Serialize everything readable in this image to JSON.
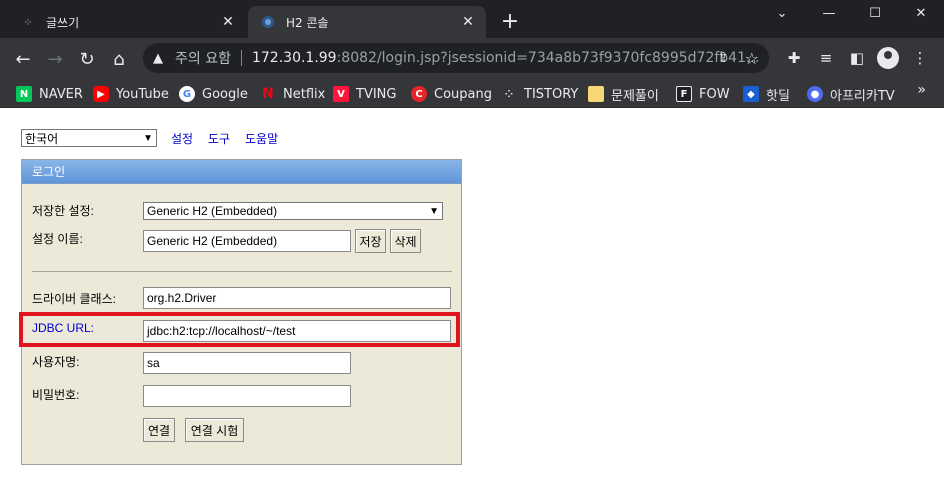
{
  "browser": {
    "tabs": [
      {
        "title": "글쓰기",
        "active": false
      },
      {
        "title": "H2 콘솔",
        "active": true
      }
    ],
    "new_tab": "+",
    "window_controls": {
      "minimize": "—",
      "maximize": "☐",
      "close": "✕",
      "tab_search": "⌄"
    },
    "address": {
      "security_label": "주의 요함",
      "host": "172.30.1.99",
      "rest": ":8082/login.jsp?jsessionid=734a8b73f9370fc8995d72fb41..."
    },
    "bookmarks": [
      {
        "label": "NAVER",
        "icon": "naver-icon",
        "color": "#03c75a",
        "glyph": "N"
      },
      {
        "label": "YouTube",
        "icon": "youtube-icon",
        "color": "#ff0000",
        "glyph": "▶"
      },
      {
        "label": "Google",
        "icon": "google-icon",
        "color": "#4285f4",
        "glyph": "G"
      },
      {
        "label": "Netflix",
        "icon": "netflix-icon",
        "color": "#e50914",
        "glyph": "N"
      },
      {
        "label": "TVING",
        "icon": "tving-icon",
        "color": "#ff153c",
        "glyph": "V"
      },
      {
        "label": "Coupang",
        "icon": "coupang-icon",
        "color": "#e52528",
        "glyph": "C"
      },
      {
        "label": "TISTORY",
        "icon": "tistory-icon",
        "color": "#35363a",
        "glyph": "⁘"
      },
      {
        "label": "문제풀이",
        "icon": "folder-icon",
        "color": "#f7d774",
        "glyph": ""
      },
      {
        "label": "FOW",
        "icon": "fow-icon",
        "color": "#202124",
        "glyph": "F"
      },
      {
        "label": "핫딜",
        "icon": "hotdeal-icon",
        "color": "#1a5fd0",
        "glyph": "◆"
      },
      {
        "label": "아프리카TV",
        "icon": "afreecatv-icon",
        "color": "#4d6cf0",
        "glyph": "●"
      }
    ],
    "bookmarks_more": "»"
  },
  "page": {
    "language": "한국어",
    "links": [
      "설정",
      "도구",
      "도움말"
    ],
    "panel_title": "로그인",
    "saved_settings_label": "저장한 설정:",
    "saved_settings_value": "Generic H2 (Embedded)",
    "setting_name_label": "설정 이름:",
    "setting_name_value": "Generic H2 (Embedded)",
    "save_button": "저장",
    "delete_button": "삭제",
    "driver_class_label": "드라이버 클래스:",
    "driver_class_value": "org.h2.Driver",
    "jdbc_url_label": "JDBC URL:",
    "jdbc_url_value": "jdbc:h2:tcp://localhost/~/test",
    "username_label": "사용자명:",
    "username_value": "sa",
    "password_label": "비밀번호:",
    "password_value": "",
    "connect_button": "연결",
    "test_button": "연결 시험"
  },
  "colors": {
    "highlight": "#e0141e",
    "panel_bg": "#ece9d8",
    "link": "#0000cc"
  }
}
